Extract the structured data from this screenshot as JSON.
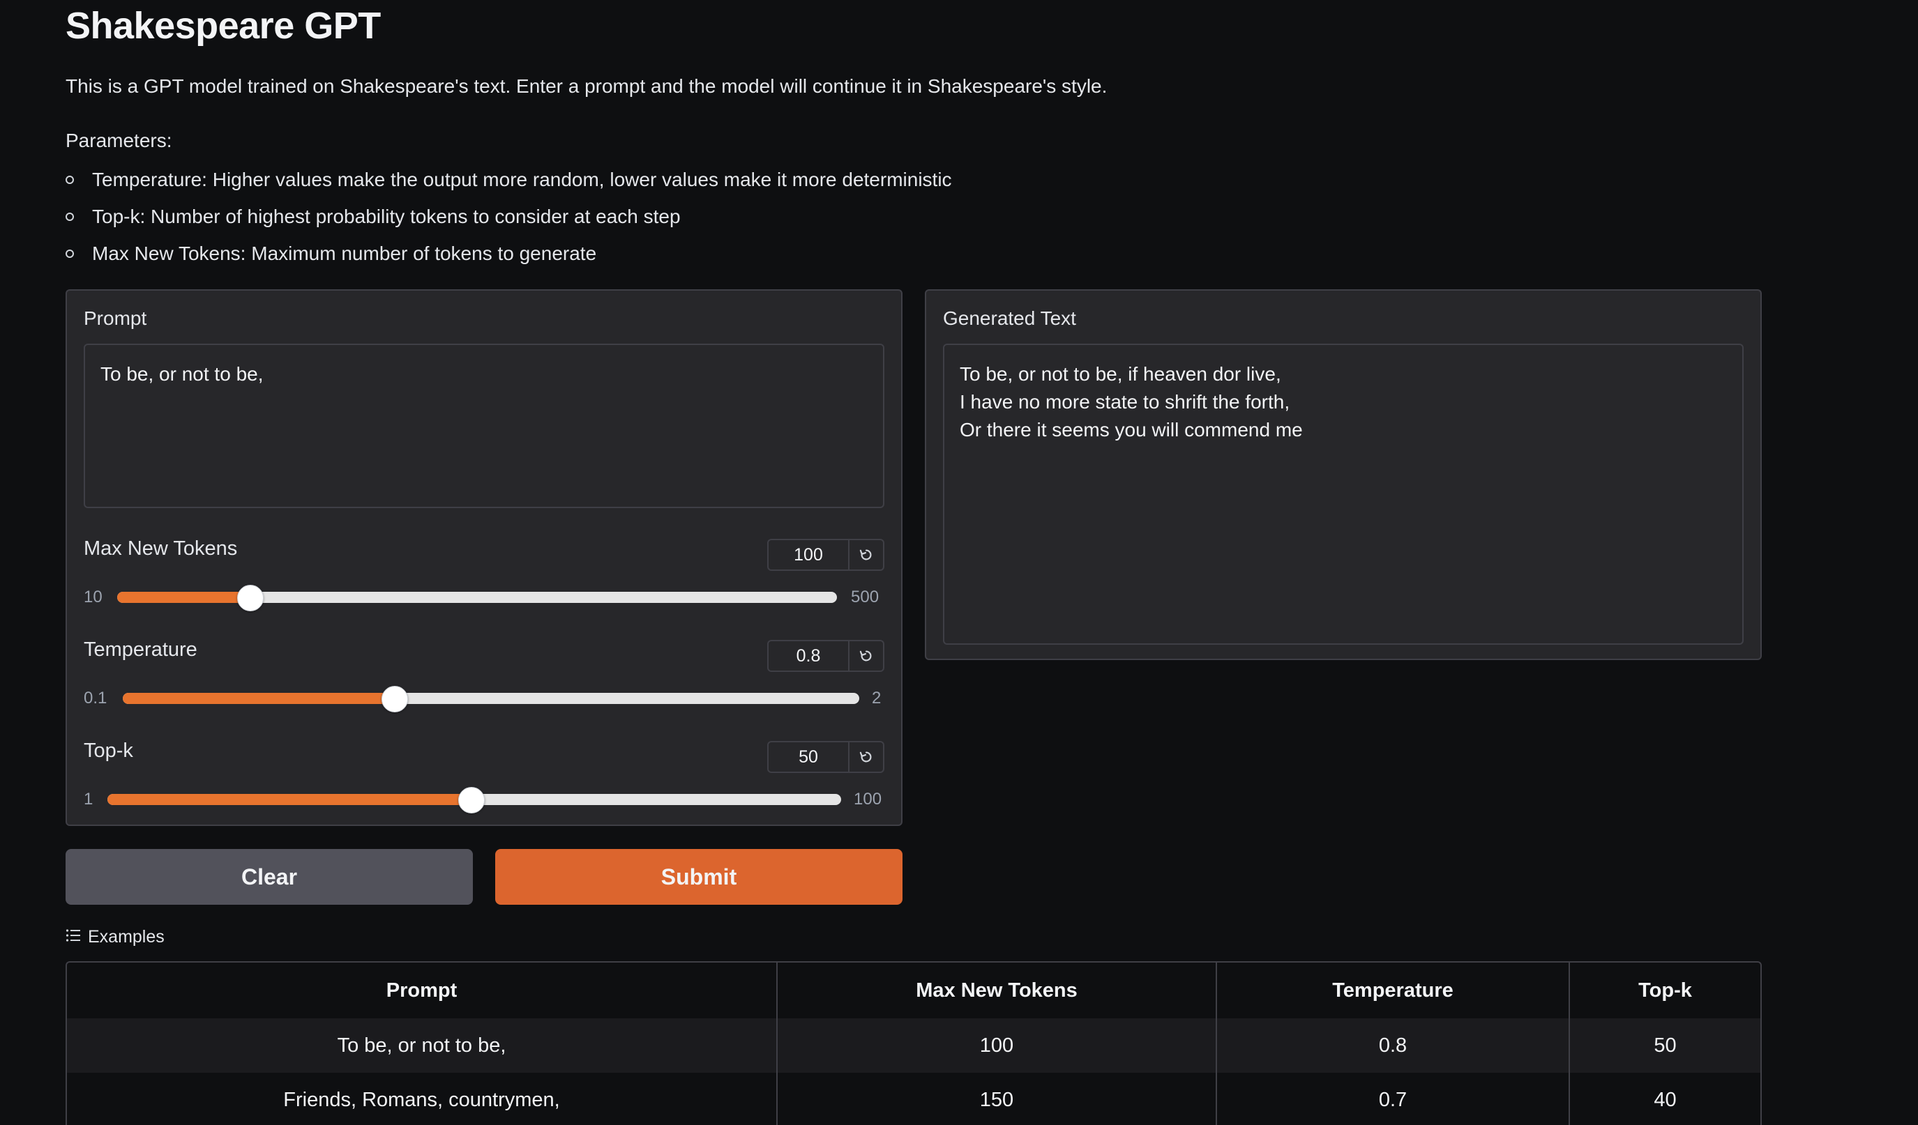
{
  "app": {
    "title": "Shakespeare GPT",
    "description": "This is a GPT model trained on Shakespeare's text. Enter a prompt and the model will continue it in Shakespeare's style.",
    "parameters_title": "Parameters:",
    "parameters": [
      "Temperature: Higher values make the output more random, lower values make it more deterministic",
      "Top-k: Number of highest probability tokens to consider at each step",
      "Max New Tokens: Maximum number of tokens to generate"
    ]
  },
  "input_panel": {
    "prompt_label": "Prompt",
    "prompt_value": "To be, or not to be,",
    "sliders": [
      {
        "label": "Max New Tokens",
        "value": "100",
        "min": "10",
        "max": "500",
        "fraction": 0.184
      },
      {
        "label": "Temperature",
        "value": "0.8",
        "min": "0.1",
        "max": "2",
        "fraction": 0.368
      },
      {
        "label": "Top-k",
        "value": "50",
        "min": "1",
        "max": "100",
        "fraction": 0.495
      }
    ]
  },
  "output_panel": {
    "label": "Generated Text",
    "value": "To be, or not to be, if heaven dor live,\nI have no more state to shrift the forth,\nOr there it seems you will commend me"
  },
  "buttons": {
    "clear": "Clear",
    "submit": "Submit"
  },
  "examples": {
    "label": "Examples",
    "icon": "list-icon",
    "headers": [
      "Prompt",
      "Max New Tokens",
      "Temperature",
      "Top-k"
    ],
    "rows": [
      [
        "To be, or not to be,",
        "100",
        "0.8",
        "50"
      ],
      [
        "Friends, Romans, countrymen,",
        "150",
        "0.7",
        "40"
      ]
    ]
  },
  "colors": {
    "accent": "#e8742e",
    "submit": "#dc652e",
    "clear": "#52525b",
    "background": "#0e0f11",
    "panel": "#27272a"
  }
}
